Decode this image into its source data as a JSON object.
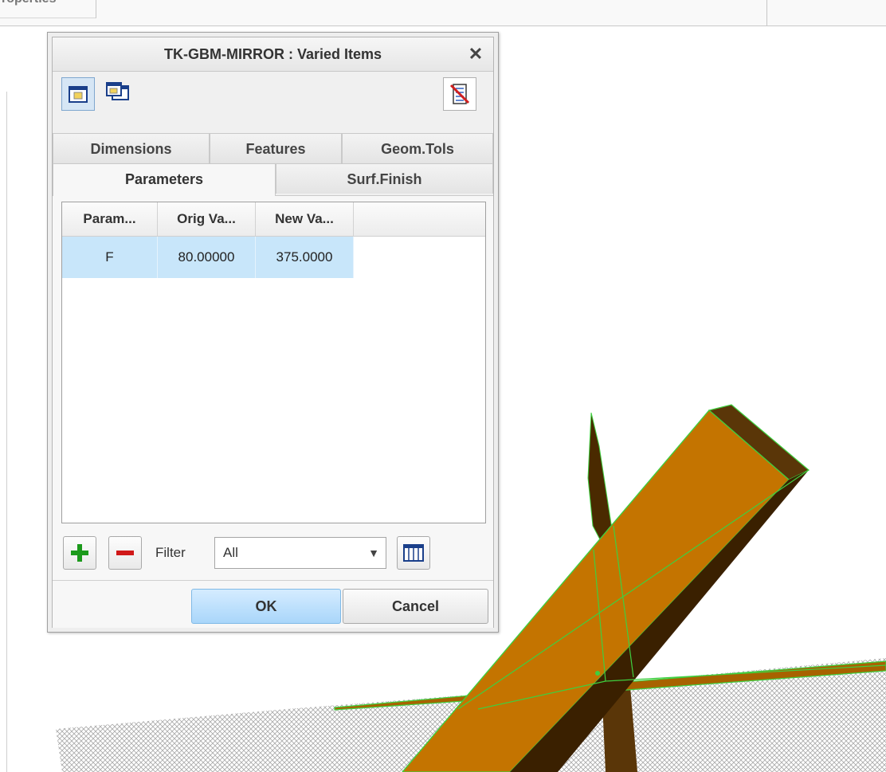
{
  "app": {
    "top_tab_fragment": "roperties"
  },
  "dialog": {
    "title": "TK-GBM-MIRROR : Varied Items",
    "close_glyph": "✕",
    "toolbar": {
      "icons": [
        "window-single-icon",
        "window-multiple-icon",
        "clear-selection-icon"
      ]
    },
    "tabs": {
      "row1": [
        "Dimensions",
        "Features",
        "Geom.Tols"
      ],
      "row2": [
        "Parameters",
        "Surf.Finish"
      ],
      "selected": "Parameters"
    },
    "table": {
      "columns": [
        "Param...",
        "Orig Va...",
        "New Va..."
      ],
      "rows": [
        {
          "param": "F",
          "orig": "80.00000",
          "new": "375.0000"
        }
      ]
    },
    "filter": {
      "label": "Filter",
      "value": "All"
    },
    "buttons": {
      "ok": "OK",
      "cancel": "Cancel"
    }
  },
  "colors": {
    "selected_row": "#c8e6fa",
    "ok_button": "#a9d6fa",
    "model_orange": "#c47400",
    "model_dark": "#5a3000",
    "edge_green": "#3fcf3f"
  }
}
